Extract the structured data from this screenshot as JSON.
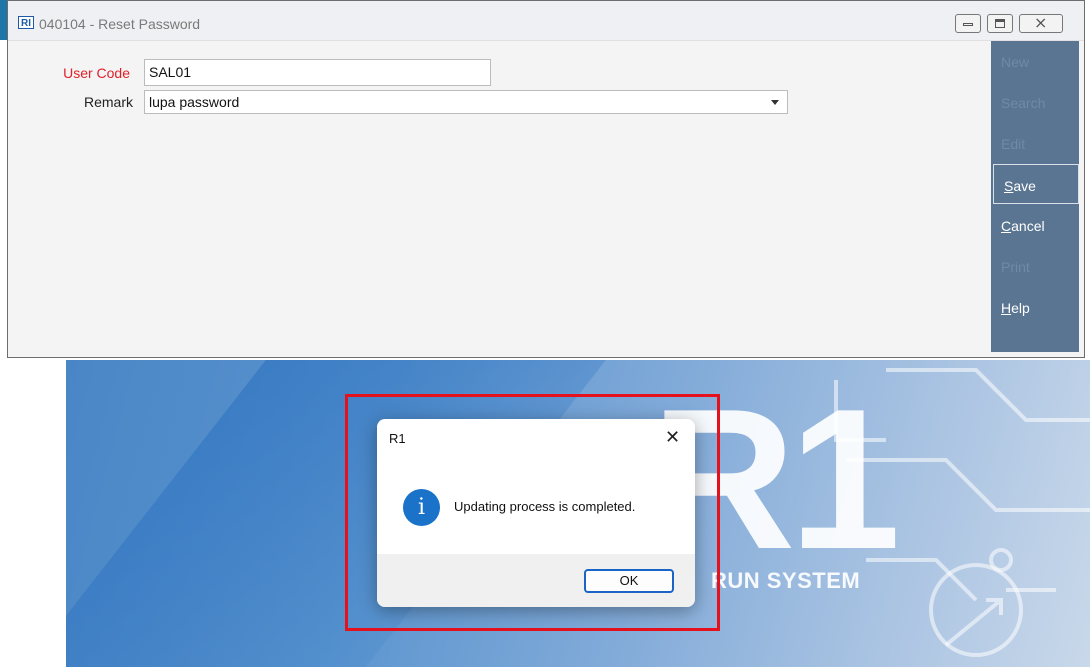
{
  "window": {
    "title": "040104 - Reset Password",
    "logo_text": "RI"
  },
  "form": {
    "user_code_label": "User Code",
    "user_code_value": "SAL01",
    "remark_label": "Remark",
    "remark_value": "lupa password"
  },
  "toolbar": {
    "items": [
      {
        "label": "New",
        "state": "disabled"
      },
      {
        "label": "Search",
        "state": "disabled"
      },
      {
        "label": "Edit",
        "state": "disabled"
      },
      {
        "label": "Save",
        "accel": "S",
        "rest": "ave",
        "state": "active"
      },
      {
        "label": "Cancel",
        "accel": "C",
        "rest": "ancel",
        "state": "enabled"
      },
      {
        "label": "Print",
        "state": "disabled"
      },
      {
        "label": "Help",
        "accel": "H",
        "rest": "elp",
        "state": "enabled"
      }
    ]
  },
  "background": {
    "logo_text": "R1",
    "tagline": "RUN SYSTEM"
  },
  "dialog": {
    "title": "R1",
    "message": "Updating process is completed.",
    "ok_label": "OK",
    "icon": "info-icon"
  },
  "colors": {
    "required_label": "#e0202a",
    "toolbar_bg": "#5a7591",
    "highlight_frame": "#e5111c",
    "info_icon": "#1a73c9"
  }
}
